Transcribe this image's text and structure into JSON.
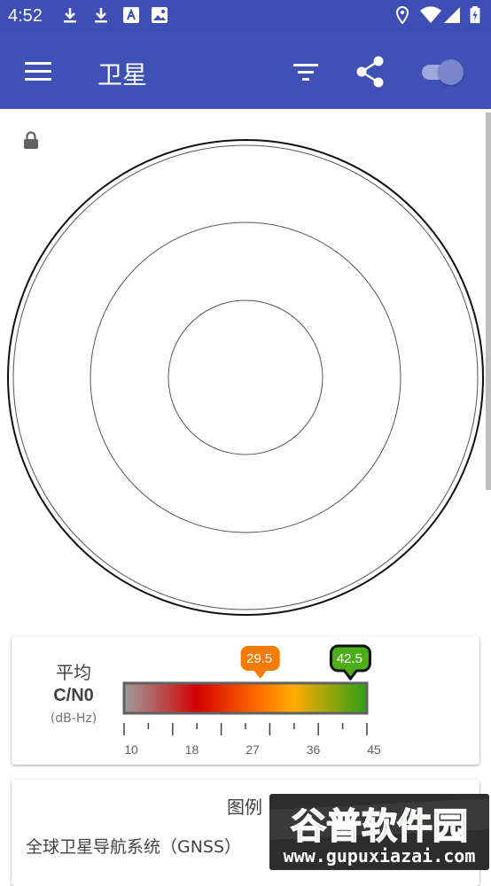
{
  "status_bar": {
    "time": "4:52",
    "left_icons": [
      "download-icon",
      "download-icon",
      "font-icon",
      "image-icon"
    ],
    "right_icons": [
      "location-icon",
      "wifi-icon",
      "signal-icon",
      "battery-icon"
    ]
  },
  "app_bar": {
    "title": "卫星",
    "menu_icon": "menu-icon",
    "filter_icon": "filter-icon",
    "share_icon": "share-icon",
    "toggle_state": "on",
    "color": "#3f51b5"
  },
  "sky_view": {
    "lock_icon": "lock-icon",
    "rings": 3
  },
  "cn0_card": {
    "label_line1": "平均",
    "label_line2": "C/N0",
    "label_unit": "(dB-Hz)",
    "marker_left_value": "29.5",
    "marker_right_value": "42.5",
    "marker_left_color": "#f57c00",
    "marker_right_color": "#4caf1a",
    "scale_ticks": [
      "10",
      "18",
      "27",
      "36",
      "45"
    ],
    "scale_min": 10,
    "scale_max": 45,
    "marker_left_num": 29.5,
    "marker_right_num": 42.5
  },
  "legend_card": {
    "title": "图例",
    "gnss_label": "全球卫星导航系统（GNSS）"
  },
  "watermark": {
    "brand": "谷普软件园",
    "url": "www.gupuxiazai.com"
  }
}
